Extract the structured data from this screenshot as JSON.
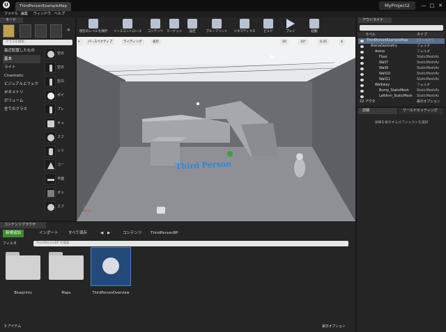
{
  "window": {
    "tab_title": "ThirdPersonExampleMap",
    "project_name": "MyProject2",
    "controls": [
      "—",
      "□",
      "✕"
    ]
  },
  "menu": [
    "ファイル",
    "編集",
    "ウィンドウ",
    "ヘルプ"
  ],
  "modes": {
    "tab_label": "モード",
    "search_placeholder": "クラスを検索",
    "categories": [
      "最近配置したもの",
      "基本",
      "ライト",
      "Cinematic",
      "ビジュアルエフェクト",
      "ジオメトリ",
      "ボリューム",
      "全てのクラス"
    ],
    "selected_category": "基本",
    "place_items": [
      "空の",
      "空の",
      "空の",
      "ポイ",
      "プレ",
      "キュ",
      "スフ",
      "シリ",
      "コー",
      "平面",
      "ボッ",
      "スフ"
    ]
  },
  "toolbar": {
    "items": [
      "現在のレベルを保存",
      "ソースコントロール",
      "コンテンツ",
      "マーケット",
      "設定",
      "ブループリント",
      "シネマティクス",
      "ビルド",
      "プレイ",
      "起動"
    ]
  },
  "viewport": {
    "perspective_label": "パースペクティブ",
    "lighting_label": "ライティング",
    "show_label": "表示",
    "grid_snap": "10",
    "rotation_snap": "10°",
    "scale_snap": "0.25",
    "camera_speed": "4",
    "floor_text": "Third Person",
    "colors": {
      "sky": "#e7eaec",
      "wall": "#6b6d72",
      "floor": "#8e9095",
      "floor_text": "#2f86d8"
    }
  },
  "outliner": {
    "tab_label": "アウトライナ",
    "col_label": "ラベル",
    "col_type": "タイプ",
    "rows": [
      {
        "name": "ThirdPersonExampleMap",
        "type": "(ワールド)",
        "indent": 0
      },
      {
        "name": "ArenaGeometry",
        "type": "フォルダ",
        "indent": 1
      },
      {
        "name": "Arena",
        "type": "フォルダ",
        "indent": 2
      },
      {
        "name": "Floor",
        "type": "StaticMeshAc",
        "indent": 3
      },
      {
        "name": "Wall7",
        "type": "StaticMeshAc",
        "indent": 3
      },
      {
        "name": "Wall9",
        "type": "StaticMeshAc",
        "indent": 3
      },
      {
        "name": "Wall10",
        "type": "StaticMeshAc",
        "indent": 3
      },
      {
        "name": "Wall11",
        "type": "StaticMeshAc",
        "indent": 3
      },
      {
        "name": "Walkway",
        "type": "フォルダ",
        "indent": 2
      },
      {
        "name": "Bump_StaticMesh",
        "type": "StaticMeshAc",
        "indent": 3
      },
      {
        "name": "LeftArm_StaticMesh",
        "type": "StaticMeshAc",
        "indent": 3
      }
    ],
    "actor_count": "22 アクタ",
    "view_options": "表示オプション"
  },
  "details": {
    "tab_details": "詳細",
    "tab_world": "ワールドセッティング",
    "hint": "詳細を表示するオブジェクトを選択"
  },
  "content_browser": {
    "tab_label": "コンテンツブラウザ",
    "add_new": "新規追加",
    "import": "インポート",
    "save_all": "すべて保存",
    "path": [
      "コンテンツ",
      "ThirdPersonBP"
    ],
    "filter_label": "フィルタ",
    "search_placeholder": "ThirdPersonBP を検索",
    "assets": [
      {
        "name": "Blueprints",
        "kind": "folder"
      },
      {
        "name": "Maps",
        "kind": "folder"
      },
      {
        "name": "ThirdPersonOverview",
        "kind": "asset"
      }
    ],
    "item_count": "3 アイテム",
    "view_options": "表示オプション"
  }
}
